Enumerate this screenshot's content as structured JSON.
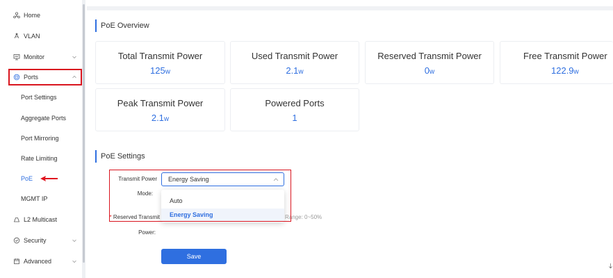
{
  "sidebar": {
    "items": [
      {
        "label": "Home",
        "icon": "home-icon"
      },
      {
        "label": "VLAN",
        "icon": "vlan-icon"
      },
      {
        "label": "Monitor",
        "icon": "monitor-icon"
      },
      {
        "label": "Ports",
        "icon": "ports-icon"
      },
      {
        "label": "L2 Multicast",
        "icon": "multicast-icon"
      },
      {
        "label": "Security",
        "icon": "shield-icon"
      },
      {
        "label": "Advanced",
        "icon": "advanced-icon"
      }
    ],
    "ports_sub": [
      "Port Settings",
      "Aggregate Ports",
      "Port Mirroring",
      "Rate Limiting",
      "PoE",
      "MGMT IP"
    ],
    "active_sub": "PoE"
  },
  "overview": {
    "title": "PoE Overview",
    "cards": [
      {
        "label": "Total Transmit Power",
        "value": "125",
        "unit": "w"
      },
      {
        "label": "Used Transmit Power",
        "value": "2.1",
        "unit": "w"
      },
      {
        "label": "Reserved Transmit Power",
        "value": "0",
        "unit": "w"
      },
      {
        "label": "Free Transmit Power",
        "value": "122.9",
        "unit": "w"
      },
      {
        "label": "Peak Transmit Power",
        "value": "2.1",
        "unit": "w"
      },
      {
        "label": "Powered Ports",
        "value": "1",
        "unit": ""
      }
    ]
  },
  "settings": {
    "title": "PoE Settings",
    "mode_label_line1": "Transmit Power",
    "mode_label_line2": "Mode:",
    "mode_value": "Energy Saving",
    "options": [
      "Auto",
      "Energy Saving"
    ],
    "selected_option": "Energy Saving",
    "reserved_label_line1": "Reserved Transmit",
    "reserved_label_line2": "Power:",
    "required_mark": "*",
    "range_hint": "Range: 0~50%",
    "save_label": "Save"
  },
  "colors": {
    "accent": "#2f6fe0",
    "highlight": "#d9141e"
  }
}
